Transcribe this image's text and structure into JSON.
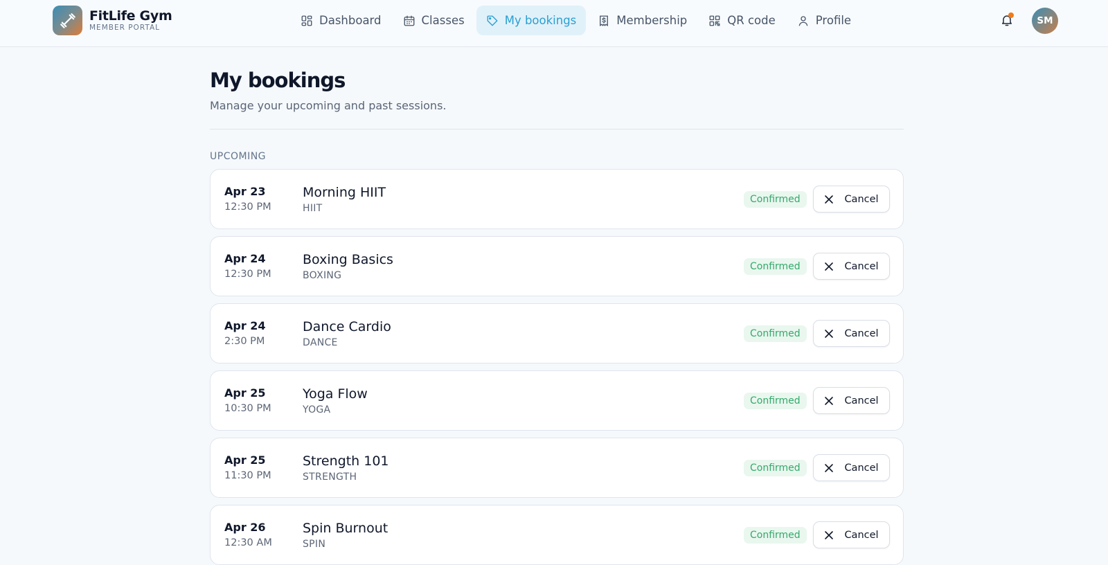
{
  "brand": {
    "name": "FitLife Gym",
    "subtitle": "MEMBER PORTAL"
  },
  "nav": [
    {
      "label": "Dashboard",
      "icon": "dashboard-icon"
    },
    {
      "label": "Classes",
      "icon": "calendar-icon"
    },
    {
      "label": "My bookings",
      "icon": "tag-icon",
      "active": true
    },
    {
      "label": "Membership",
      "icon": "receipt-icon"
    },
    {
      "label": "QR code",
      "icon": "qr-code-icon"
    },
    {
      "label": "Profile",
      "icon": "user-icon"
    }
  ],
  "header": {
    "notifications_icon": "bell-icon",
    "avatar_initials": "SM"
  },
  "page": {
    "title": "My bookings",
    "subtitle": "Manage your upcoming and past sessions.",
    "section_label": "UPCOMING"
  },
  "bookings": [
    {
      "date": "Apr 23",
      "time": "12:30 PM",
      "name": "Morning HIIT",
      "type": "HIIT",
      "status": "Confirmed",
      "action": "Cancel"
    },
    {
      "date": "Apr 24",
      "time": "12:30 PM",
      "name": "Boxing Basics",
      "type": "BOXING",
      "status": "Confirmed",
      "action": "Cancel"
    },
    {
      "date": "Apr 24",
      "time": "2:30 PM",
      "name": "Dance Cardio",
      "type": "DANCE",
      "status": "Confirmed",
      "action": "Cancel"
    },
    {
      "date": "Apr 25",
      "time": "10:30 PM",
      "name": "Yoga Flow",
      "type": "YOGA",
      "status": "Confirmed",
      "action": "Cancel"
    },
    {
      "date": "Apr 25",
      "time": "11:30 PM",
      "name": "Strength 101",
      "type": "STRENGTH",
      "status": "Confirmed",
      "action": "Cancel"
    },
    {
      "date": "Apr 26",
      "time": "12:30 AM",
      "name": "Spin Burnout",
      "type": "SPIN",
      "status": "Confirmed",
      "action": "Cancel"
    }
  ],
  "colors": {
    "accent": "#2a9fd2",
    "accent_bg": "#e1f1f9",
    "status_green": "#34a96a",
    "notification_dot": "#f07a1c"
  }
}
